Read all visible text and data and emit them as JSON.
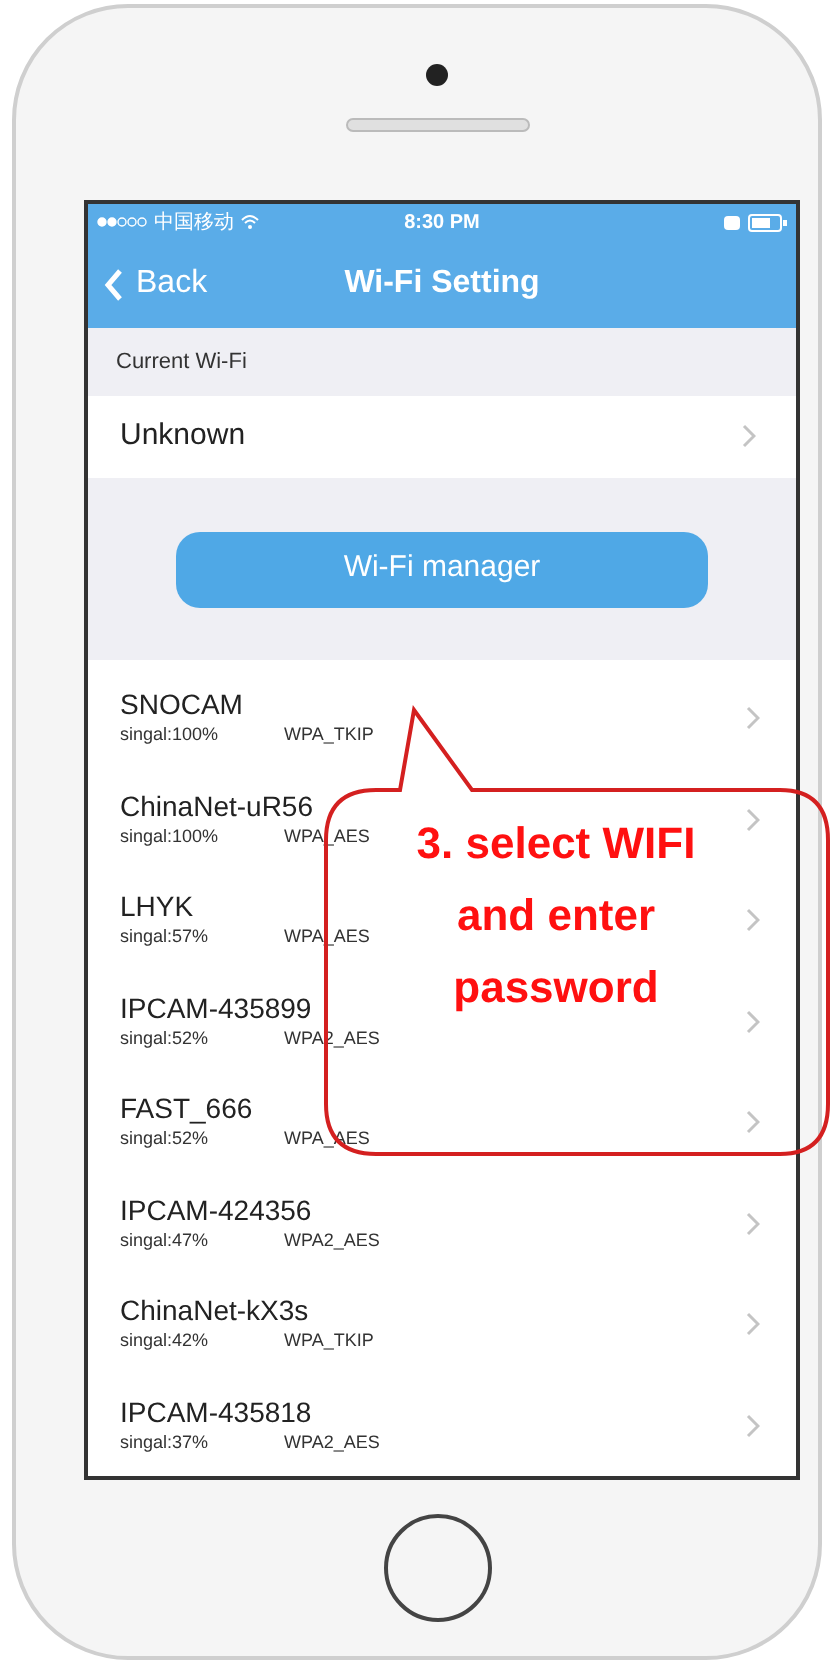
{
  "status_bar": {
    "carrier": "中国移动",
    "time": "8:30 PM"
  },
  "nav": {
    "back": "Back",
    "title": "Wi-Fi Setting"
  },
  "current_wifi": {
    "header": "Current Wi-Fi",
    "value": "Unknown"
  },
  "manager_button": {
    "label": "Wi-Fi manager"
  },
  "networks": [
    {
      "name": "SNOCAM",
      "signal": "singal:100%",
      "security": "WPA_TKIP"
    },
    {
      "name": "ChinaNet-uR56",
      "signal": "singal:100%",
      "security": "WPA_AES"
    },
    {
      "name": "LHYK",
      "signal": "singal:57%",
      "security": "WPA_AES"
    },
    {
      "name": "IPCAM-435899",
      "signal": "singal:52%",
      "security": "WPA2_AES"
    },
    {
      "name": "FAST_666",
      "signal": "singal:52%",
      "security": "WPA_AES"
    },
    {
      "name": "IPCAM-424356",
      "signal": "singal:47%",
      "security": "WPA2_AES"
    },
    {
      "name": "ChinaNet-kX3s",
      "signal": "singal:42%",
      "security": "WPA_TKIP"
    },
    {
      "name": "IPCAM-435818",
      "signal": "singal:37%",
      "security": "WPA2_AES"
    }
  ],
  "callout": {
    "text": "3. select WIFI and enter password"
  }
}
